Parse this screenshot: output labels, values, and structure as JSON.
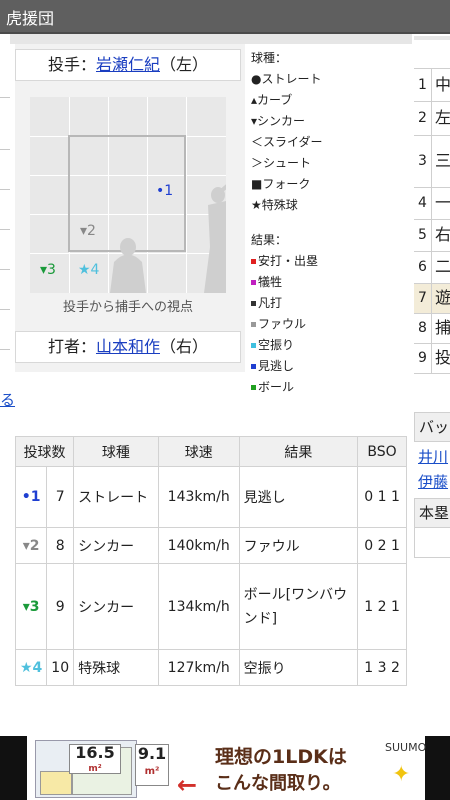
{
  "app": {
    "title": "虎援団"
  },
  "pitcher": {
    "label": "投手：",
    "name": "岩瀬仁紀",
    "hand": "（左）"
  },
  "batter": {
    "label": "打者：",
    "name": "山本和作",
    "hand": "（右）"
  },
  "zone": {
    "caption": "投手から捕手への視点",
    "marks": [
      {
        "label": "•1",
        "color": "#1f3fd1"
      },
      {
        "label": "▾2",
        "color": "#888888"
      },
      {
        "label": "▾3",
        "color": "#1a9a3a"
      },
      {
        "label": "★4",
        "color": "#4fc0dd"
      }
    ]
  },
  "legend": {
    "pitch_types_title": "球種：",
    "pitch_types": [
      "●ストレート",
      "▴カーブ",
      "▾シンカー",
      "＜スライダー",
      "＞シュート",
      "■フォーク",
      "★特殊球"
    ],
    "results_title": "結果：",
    "results": [
      {
        "label": "安打・出塁",
        "color": "#e02020"
      },
      {
        "label": "犠牲",
        "color": "#c020c0"
      },
      {
        "label": "凡打",
        "color": "#333333"
      },
      {
        "label": "ファウル",
        "color": "#999999"
      },
      {
        "label": "空振り",
        "color": "#40c0e0"
      },
      {
        "label": "見逃し",
        "color": "#1f3fd1"
      },
      {
        "label": "ボール",
        "color": "#20a020"
      }
    ]
  },
  "pitch_table": {
    "headers": [
      "投球数",
      "球種",
      "球速",
      "結果",
      "BSO"
    ],
    "rows": [
      {
        "mark": "•1",
        "mark_color": "#1f3fd1",
        "count": "7",
        "type": "ストレート",
        "speed": "143km/h",
        "result": "見逃し",
        "bso": "0 1 1"
      },
      {
        "mark": "▾2",
        "mark_color": "#888888",
        "count": "8",
        "type": "シンカー",
        "speed": "140km/h",
        "result": "ファウル",
        "bso": "0 2 1"
      },
      {
        "mark": "▾3",
        "mark_color": "#1a9a3a",
        "count": "9",
        "type": "シンカー",
        "speed": "134km/h",
        "result": "ボール[ワンバウンド]",
        "bso": "1 2 1"
      },
      {
        "mark": "★4",
        "mark_color": "#4fc0dd",
        "count": "10",
        "type": "特殊球",
        "speed": "127km/h",
        "result": "空振り",
        "bso": "1 3 2"
      }
    ]
  },
  "right_lineup": {
    "rows": [
      {
        "num": "1",
        "text": "中"
      },
      {
        "num": "2",
        "text": "左"
      },
      {
        "num": "3",
        "text": "三"
      },
      {
        "num": "4",
        "text": "一"
      },
      {
        "num": "5",
        "text": "右"
      },
      {
        "num": "6",
        "text": "二"
      },
      {
        "num": "7",
        "text": "遊"
      },
      {
        "num": "8",
        "text": "捕"
      },
      {
        "num": "9",
        "text": "投"
      }
    ],
    "batting_header": "バッ",
    "batting_names": [
      "井川",
      "伊藤"
    ],
    "homerun_header": "本塁"
  },
  "left_partial": {
    "link": "る"
  },
  "ad": {
    "size1": "16.5",
    "size2": "9.1",
    "unit": "m²",
    "headline_line1": "理想の1LDKは",
    "headline_line2": "こんな間取り。",
    "brand": "SUUMO"
  }
}
